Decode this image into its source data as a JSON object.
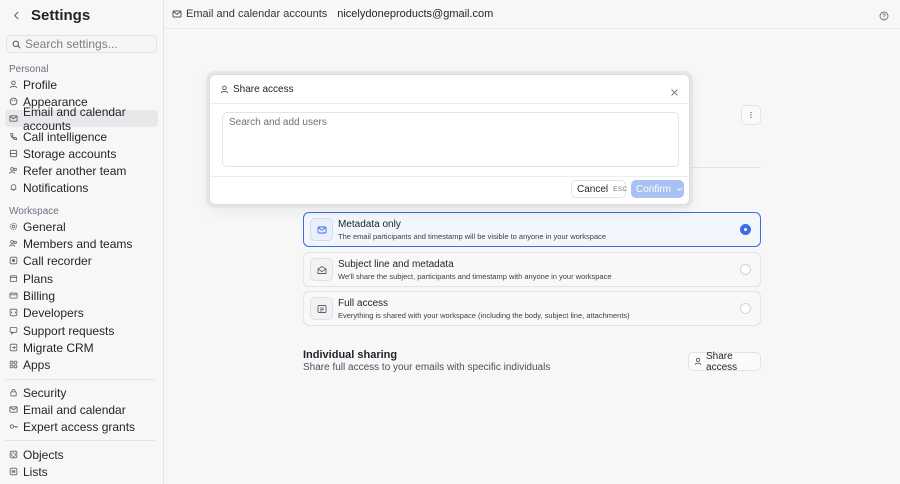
{
  "sidebar": {
    "title": "Settings",
    "search_placeholder": "Search settings...",
    "personal_label": "Personal",
    "workspace_label": "Workspace",
    "personal_items": [
      {
        "label": "Profile",
        "icon": "user-icon"
      },
      {
        "label": "Appearance",
        "icon": "palette-icon"
      },
      {
        "label": "Email and calendar accounts",
        "icon": "mail-icon"
      },
      {
        "label": "Call intelligence",
        "icon": "phone-icon"
      },
      {
        "label": "Storage accounts",
        "icon": "storage-icon"
      },
      {
        "label": "Refer another team",
        "icon": "users-icon"
      },
      {
        "label": "Notifications",
        "icon": "bell-icon"
      }
    ],
    "workspace_items": [
      {
        "label": "General",
        "icon": "gear-icon"
      },
      {
        "label": "Members and teams",
        "icon": "users-icon"
      },
      {
        "label": "Call recorder",
        "icon": "record-icon"
      },
      {
        "label": "Plans",
        "icon": "box-icon"
      },
      {
        "label": "Billing",
        "icon": "card-icon"
      },
      {
        "label": "Developers",
        "icon": "code-icon"
      },
      {
        "label": "Support requests",
        "icon": "support-icon"
      },
      {
        "label": "Migrate CRM",
        "icon": "migrate-icon"
      },
      {
        "label": "Apps",
        "icon": "apps-icon"
      }
    ],
    "security_items": [
      {
        "label": "Security",
        "icon": "lock-icon"
      },
      {
        "label": "Email and calendar",
        "icon": "mail-icon"
      },
      {
        "label": "Expert access grants",
        "icon": "key-icon"
      }
    ],
    "data_items": [
      {
        "label": "Objects",
        "icon": "cube-icon"
      },
      {
        "label": "Lists",
        "icon": "list-icon"
      }
    ]
  },
  "topbar": {
    "crumb": "Email and calendar accounts",
    "email": "nicelydoneproducts@gmail.com"
  },
  "options": [
    {
      "title": "Metadata only",
      "desc": "The email participants and timestamp will be visible to anyone in your workspace",
      "selected": true
    },
    {
      "title": "Subject line and metadata",
      "desc": "We'll share the subject, participants and timestamp with anyone in your workspace",
      "selected": false
    },
    {
      "title": "Full access",
      "desc": "Everything is shared with your workspace (including the body, subject line, attachments)",
      "selected": false
    }
  ],
  "individual": {
    "title": "Individual sharing",
    "desc": "Share full access to your emails with specific individuals",
    "button": "Share access"
  },
  "modal": {
    "title": "Share access",
    "input_placeholder": "Search and add users",
    "cancel": "Cancel",
    "cancel_kbd": "ESC",
    "confirm": "Confirm",
    "confirm_kbd": "↵"
  },
  "colors": {
    "accent": "#3b6ee6",
    "confirm_disabled": "#a8c0f2"
  }
}
